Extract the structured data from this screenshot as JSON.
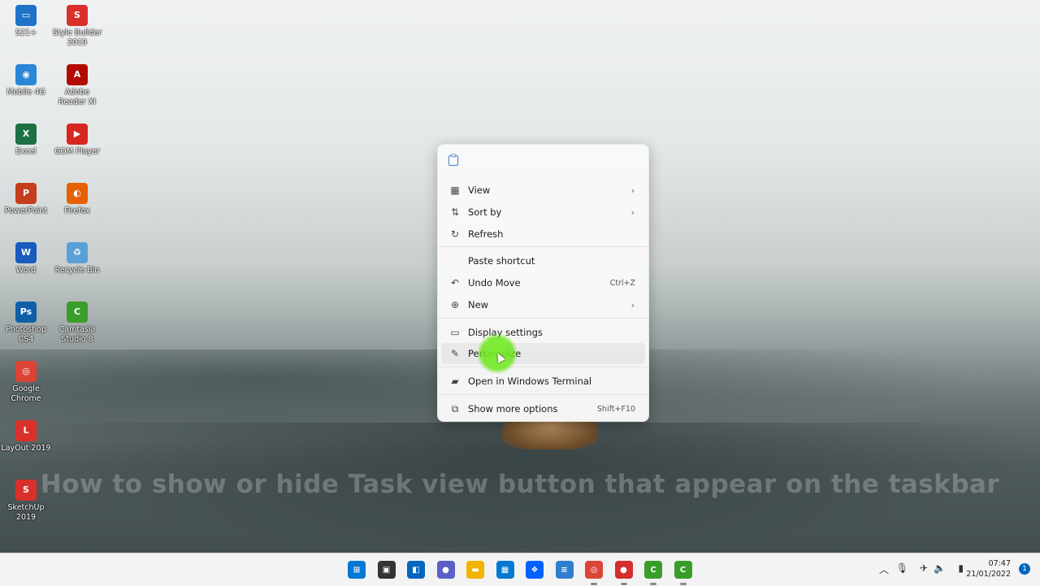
{
  "desktop": {
    "icons": [
      {
        "label": "S21+",
        "glyph": "▭",
        "color": "#1e73c8"
      },
      {
        "label": "Style Builder 2019",
        "glyph": "S",
        "color": "#d9302c"
      },
      {
        "label": "Mobile 4G",
        "glyph": "◉",
        "color": "#2a86d6"
      },
      {
        "label": "Adobe Reader XI",
        "glyph": "A",
        "color": "#b30b00"
      },
      {
        "label": "Excel",
        "glyph": "X",
        "color": "#1d7044"
      },
      {
        "label": "GOM Player",
        "glyph": "▶",
        "color": "#d7261f"
      },
      {
        "label": "PowerPoint",
        "glyph": "P",
        "color": "#c43e1c"
      },
      {
        "label": "Firefox",
        "glyph": "◐",
        "color": "#e66000"
      },
      {
        "label": "Word",
        "glyph": "W",
        "color": "#185abd"
      },
      {
        "label": "Recycle Bin",
        "glyph": "♻",
        "color": "#5aa0d8"
      },
      {
        "label": "Photoshop CS4",
        "glyph": "Ps",
        "color": "#0f5fa8"
      },
      {
        "label": "Camtasia Studio 8",
        "glyph": "C",
        "color": "#3a9d2a"
      },
      {
        "label": "Google Chrome",
        "glyph": "◎",
        "color": "#db4437"
      },
      {
        "label": "LayOut 2019",
        "glyph": "L",
        "color": "#d9302c"
      },
      {
        "label": "SketchUp 2019",
        "glyph": "S",
        "color": "#d9302c"
      }
    ]
  },
  "caption": "How to show or hide Task view button that appear on the taskbar",
  "context_menu": {
    "items": [
      {
        "label": "View",
        "icon": "grid-icon",
        "submenu": true
      },
      {
        "label": "Sort by",
        "icon": "sort-icon",
        "submenu": true
      },
      {
        "label": "Refresh",
        "icon": "refresh-icon"
      },
      {
        "label": "Paste shortcut",
        "icon": ""
      },
      {
        "label": "Undo Move",
        "icon": "undo-icon",
        "shortcut": "Ctrl+Z"
      },
      {
        "label": "New",
        "icon": "plus-circle-icon",
        "submenu": true
      },
      {
        "label": "Display settings",
        "icon": "display-icon"
      },
      {
        "label": "Personalize",
        "icon": "pen-icon"
      },
      {
        "label": "Open in Windows Terminal",
        "icon": "terminal-icon"
      },
      {
        "label": "Show more options",
        "icon": "share-icon",
        "shortcut": "Shift+F10"
      }
    ],
    "hovered": "Personalize"
  },
  "taskbar": {
    "apps": [
      {
        "name": "Start",
        "glyph": "⊞",
        "color": "#0078d4"
      },
      {
        "name": "Task View",
        "glyph": "▣",
        "color": "#333333"
      },
      {
        "name": "Widgets",
        "glyph": "◧",
        "color": "#0067c0"
      },
      {
        "name": "Chat",
        "glyph": "●",
        "color": "#5b5fc7"
      },
      {
        "name": "File Explorer",
        "glyph": "▬",
        "color": "#f2b400"
      },
      {
        "name": "Microsoft Store",
        "glyph": "▦",
        "color": "#0078d4"
      },
      {
        "name": "Dropbox",
        "glyph": "❖",
        "color": "#0061fe"
      },
      {
        "name": "Notepad",
        "glyph": "≡",
        "color": "#2f7fd0"
      },
      {
        "name": "Google Chrome",
        "glyph": "◎",
        "color": "#db4437"
      },
      {
        "name": "Recorder",
        "glyph": "●",
        "color": "#d32f2f"
      },
      {
        "name": "Camtasia",
        "glyph": "C",
        "color": "#3a9d2a"
      },
      {
        "name": "Camtasia Recorder",
        "glyph": "C",
        "color": "#3a9d2a"
      }
    ],
    "time": "07:47",
    "date": "21/01/2022",
    "notifications": "1"
  }
}
